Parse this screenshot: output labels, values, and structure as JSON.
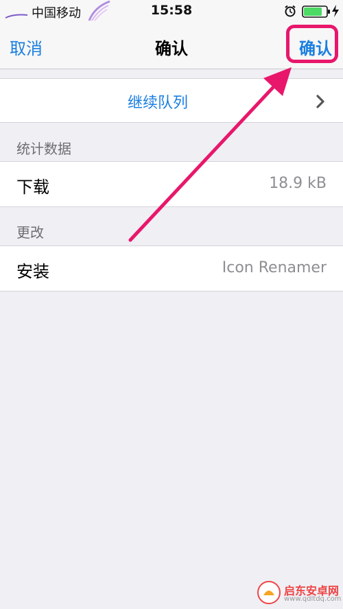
{
  "status_bar": {
    "carrier": "中国移动",
    "time": "15:58",
    "icons": [
      "carrier-signal-icon",
      "feather-icon",
      "alarm-icon",
      "battery-icon",
      "charging-bolt-icon"
    ],
    "battery_color": "#4cd964"
  },
  "nav": {
    "cancel_label": "取消",
    "title": "确认",
    "confirm_label": "确认"
  },
  "queue": {
    "label": "继续队列",
    "chevron": "chevron-right-icon"
  },
  "sections": {
    "stats": {
      "header": "统计数据",
      "row_key": "下载",
      "row_value": "18.9 kB"
    },
    "changes": {
      "header": "更改",
      "row_key": "安装",
      "row_value": "Icon Renamer"
    }
  },
  "annotation": {
    "highlight_color": "#e8176b"
  },
  "watermark": {
    "title": "启东安卓网",
    "url": "www.qdltdq.com"
  },
  "colors": {
    "accent": "#1a7fe0",
    "background": "#efeff4",
    "secondary_text": "#8e8e93"
  }
}
